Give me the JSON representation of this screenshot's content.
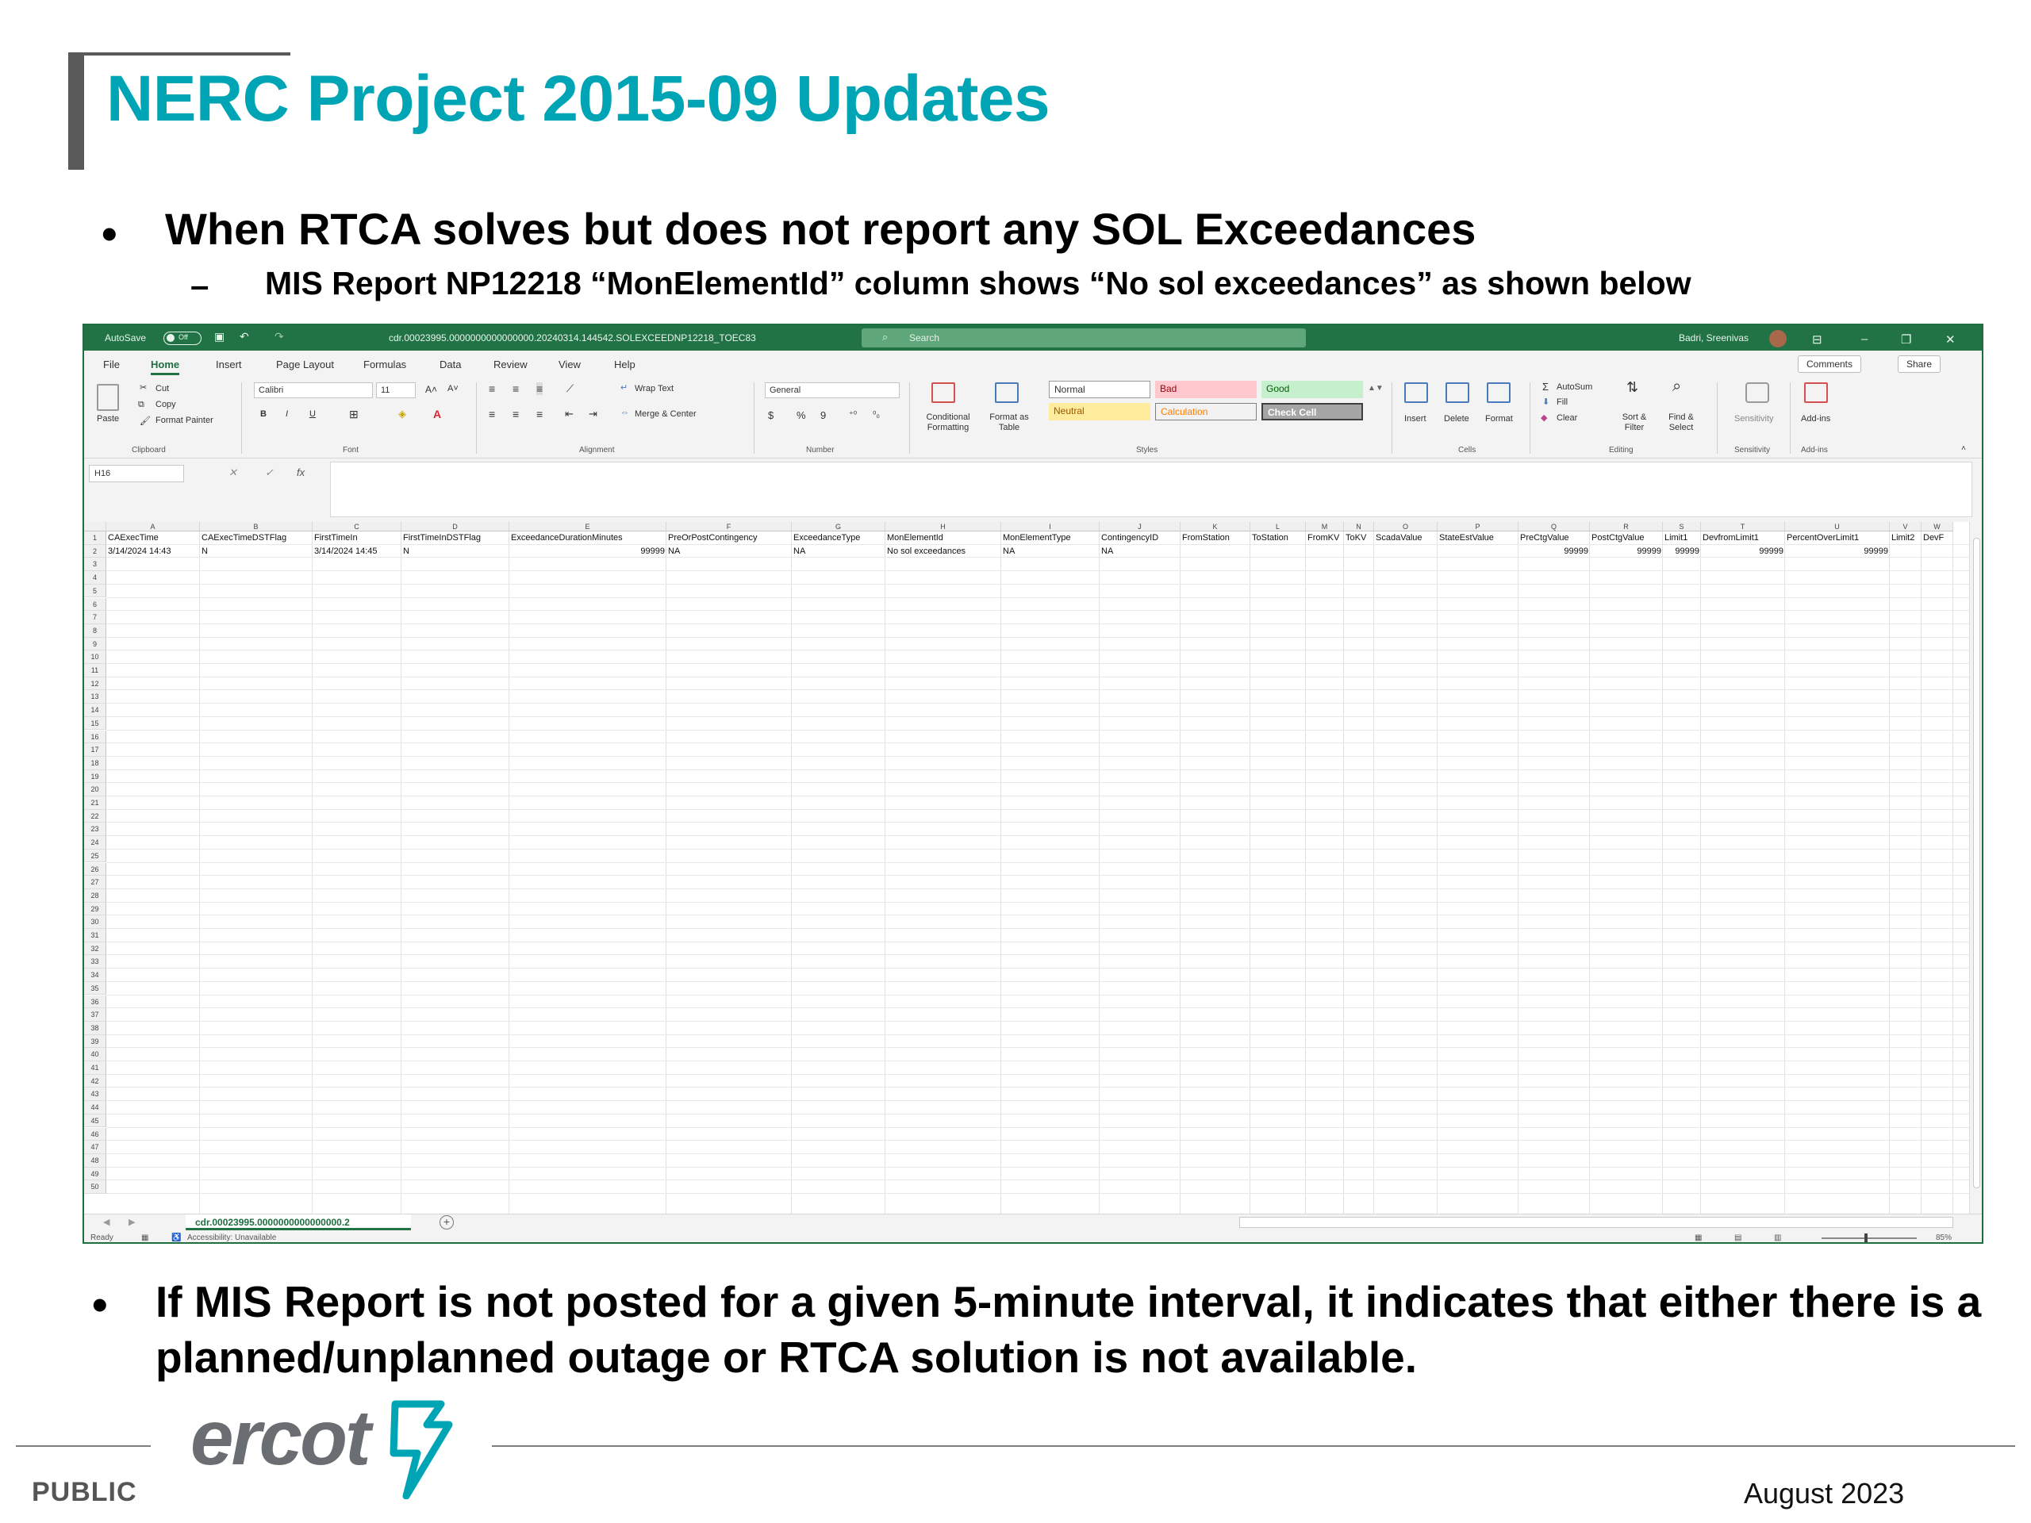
{
  "slide": {
    "title": "NERC Project 2015-09 Updates",
    "bullet1": "When RTCA solves but does not report any SOL Exceedances",
    "bullet1_sub": "MIS Report NP12218 “MonElementId” column shows “No sol exceedances” as shown below",
    "bullet2": "If MIS Report is not posted for a given 5-minute interval, it indicates that either there is a planned/unplanned outage or RTCA solution is not available.",
    "footer_label": "PUBLIC",
    "footer_date": "August 2023",
    "logo_text": "ercot",
    "bullet_char": "•",
    "dash_char": "–",
    "colors": {
      "title": "#00a5b5",
      "excel_green": "#217346"
    }
  },
  "excel": {
    "titlebar": {
      "autosave_label": "AutoSave",
      "autosave_state": "Off",
      "filename": "cdr.00023995.0000000000000000.20240314.144542.SOLEXCEEDNP12218_TOEC83",
      "search_placeholder": "Search",
      "user": "Badri, Sreenivas",
      "icons": [
        "save-icon",
        "undo-icon",
        "redo-icon",
        "search-icon",
        "ribbon-display-icon",
        "minimize-icon",
        "maximize-icon",
        "close-icon"
      ]
    },
    "tabs": [
      "File",
      "Home",
      "Insert",
      "Page Layout",
      "Formulas",
      "Data",
      "Review",
      "View",
      "Help"
    ],
    "active_tab": "Home",
    "comments_label": "Comments",
    "share_label": "Share",
    "ribbon": {
      "clipboard": {
        "paste": "Paste",
        "cut": "Cut",
        "copy": "Copy",
        "format_painter": "Format Painter",
        "group": "Clipboard"
      },
      "font": {
        "name": "Calibri",
        "size": "11",
        "bold": "B",
        "italic": "I",
        "underline": "U",
        "group": "Font",
        "grow": "A˄",
        "shrink": "A˅"
      },
      "alignment": {
        "wrap": "Wrap Text",
        "merge": "Merge & Center",
        "group": "Alignment"
      },
      "number": {
        "format": "General",
        "currency": "$",
        "percent": "%",
        "comma": "9",
        "group": "Number"
      },
      "styles": {
        "conditional": "Conditional Formatting",
        "format_table": "Format as Table",
        "normal": "Normal",
        "bad": "Bad",
        "good": "Good",
        "neutral": "Neutral",
        "calculation": "Calculation",
        "check_cell": "Check Cell",
        "group": "Styles"
      },
      "cells": {
        "insert": "Insert",
        "delete": "Delete",
        "format": "Format",
        "group": "Cells"
      },
      "editing": {
        "autosum": "AutoSum",
        "fill": "Fill",
        "clear": "Clear",
        "sort": "Sort & Filter",
        "find": "Find & Select",
        "group": "Editing"
      },
      "sensitivity": {
        "label": "Sensitivity",
        "group": "Sensitivity"
      },
      "addins": {
        "label": "Add-ins",
        "group": "Add-ins"
      }
    },
    "namebox": "H16",
    "fx": "fx",
    "columns": [
      {
        "letter": "A",
        "header": "CAExecTime",
        "value": "3/14/2024 14:43",
        "num": false
      },
      {
        "letter": "B",
        "header": "CAExecTimeDSTFlag",
        "value": "N",
        "num": false
      },
      {
        "letter": "C",
        "header": "FirstTimeIn",
        "value": "3/14/2024 14:45",
        "num": false
      },
      {
        "letter": "D",
        "header": "FirstTimeInDSTFlag",
        "value": "N",
        "num": false
      },
      {
        "letter": "E",
        "header": "ExceedanceDurationMinutes",
        "value": "99999",
        "num": true
      },
      {
        "letter": "F",
        "header": "PreOrPostContingency",
        "value": "NA",
        "num": false
      },
      {
        "letter": "G",
        "header": "ExceedanceType",
        "value": "NA",
        "num": false
      },
      {
        "letter": "H",
        "header": "MonElementId",
        "value": "No sol exceedances",
        "num": false
      },
      {
        "letter": "I",
        "header": "MonElementType",
        "value": "NA",
        "num": false
      },
      {
        "letter": "J",
        "header": "ContingencyID",
        "value": "NA",
        "num": false
      },
      {
        "letter": "K",
        "header": "FromStation",
        "value": "",
        "num": false
      },
      {
        "letter": "L",
        "header": "ToStation",
        "value": "",
        "num": false
      },
      {
        "letter": "M",
        "header": "FromKV",
        "value": "",
        "num": false
      },
      {
        "letter": "N",
        "header": "ToKV",
        "value": "",
        "num": false
      },
      {
        "letter": "O",
        "header": "ScadaValue",
        "value": "",
        "num": false
      },
      {
        "letter": "P",
        "header": "StateEstValue",
        "value": "",
        "num": false
      },
      {
        "letter": "Q",
        "header": "PreCtgValue",
        "value": "99999",
        "num": true
      },
      {
        "letter": "R",
        "header": "PostCtgValue",
        "value": "99999",
        "num": true
      },
      {
        "letter": "S",
        "header": "Limit1",
        "value": "99999",
        "num": true
      },
      {
        "letter": "T",
        "header": "DevfromLimit1",
        "value": "99999",
        "num": true
      },
      {
        "letter": "U",
        "header": "PercentOverLimit1",
        "value": "99999",
        "num": true
      },
      {
        "letter": "V",
        "header": "Limit2",
        "value": "",
        "num": false
      },
      {
        "letter": "W",
        "header": "DevF",
        "value": "",
        "num": false
      }
    ],
    "row_count": 50,
    "sheet_tab": "cdr.00023995.0000000000000000.2",
    "status": {
      "ready": "Ready",
      "accessibility": "Accessibility: Unavailable",
      "zoom": "85%"
    }
  }
}
